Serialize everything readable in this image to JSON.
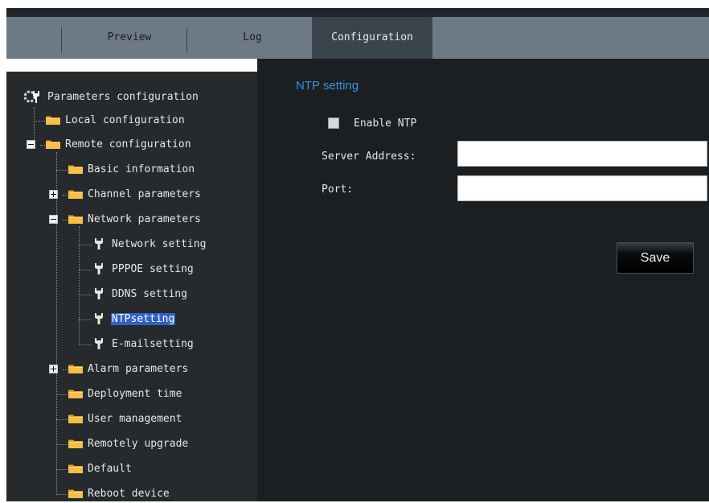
{
  "tabs": [
    {
      "label": "Preview",
      "active": false
    },
    {
      "label": "Log",
      "active": false
    },
    {
      "label": "Configuration",
      "active": true
    }
  ],
  "tree": {
    "root": "Parameters configuration",
    "items": [
      {
        "label": "Local configuration",
        "icon": "folder-icon"
      },
      {
        "label": "Remote configuration",
        "icon": "folder-icon",
        "expanded": true
      },
      {
        "label": "Basic information",
        "icon": "folder-icon"
      },
      {
        "label": "Channel parameters",
        "icon": "folder-icon",
        "expanded": false
      },
      {
        "label": "Network parameters",
        "icon": "folder-icon",
        "expanded": true
      },
      {
        "label": "Network setting",
        "icon": "wrench-icon"
      },
      {
        "label": "PPPOE setting",
        "icon": "wrench-icon"
      },
      {
        "label": "DDNS setting",
        "icon": "wrench-icon"
      },
      {
        "label": "NTPsetting",
        "icon": "wrench-icon",
        "selected": true
      },
      {
        "label": "E-mailsetting",
        "icon": "wrench-icon"
      },
      {
        "label": "Alarm parameters",
        "icon": "folder-icon",
        "expanded": false
      },
      {
        "label": "Deployment time",
        "icon": "folder-icon"
      },
      {
        "label": "User management",
        "icon": "folder-icon"
      },
      {
        "label": "Remotely upgrade",
        "icon": "folder-icon"
      },
      {
        "label": "Default",
        "icon": "folder-icon"
      },
      {
        "label": "Reboot device",
        "icon": "folder-icon"
      }
    ]
  },
  "ntp": {
    "title": "NTP setting",
    "enable_label": "Enable NTP",
    "enable_checked": false,
    "server_address_label": "Server Address:",
    "server_address_value": "",
    "port_label": "Port:",
    "port_value": "",
    "save_label": "Save"
  },
  "colors": {
    "accent": "#3b8fe0",
    "selection": "#2f62c6",
    "folder": "#f2b53a",
    "panel": "#262a2d",
    "content": "#1b1f22",
    "tabbar": "#6d7a86"
  }
}
